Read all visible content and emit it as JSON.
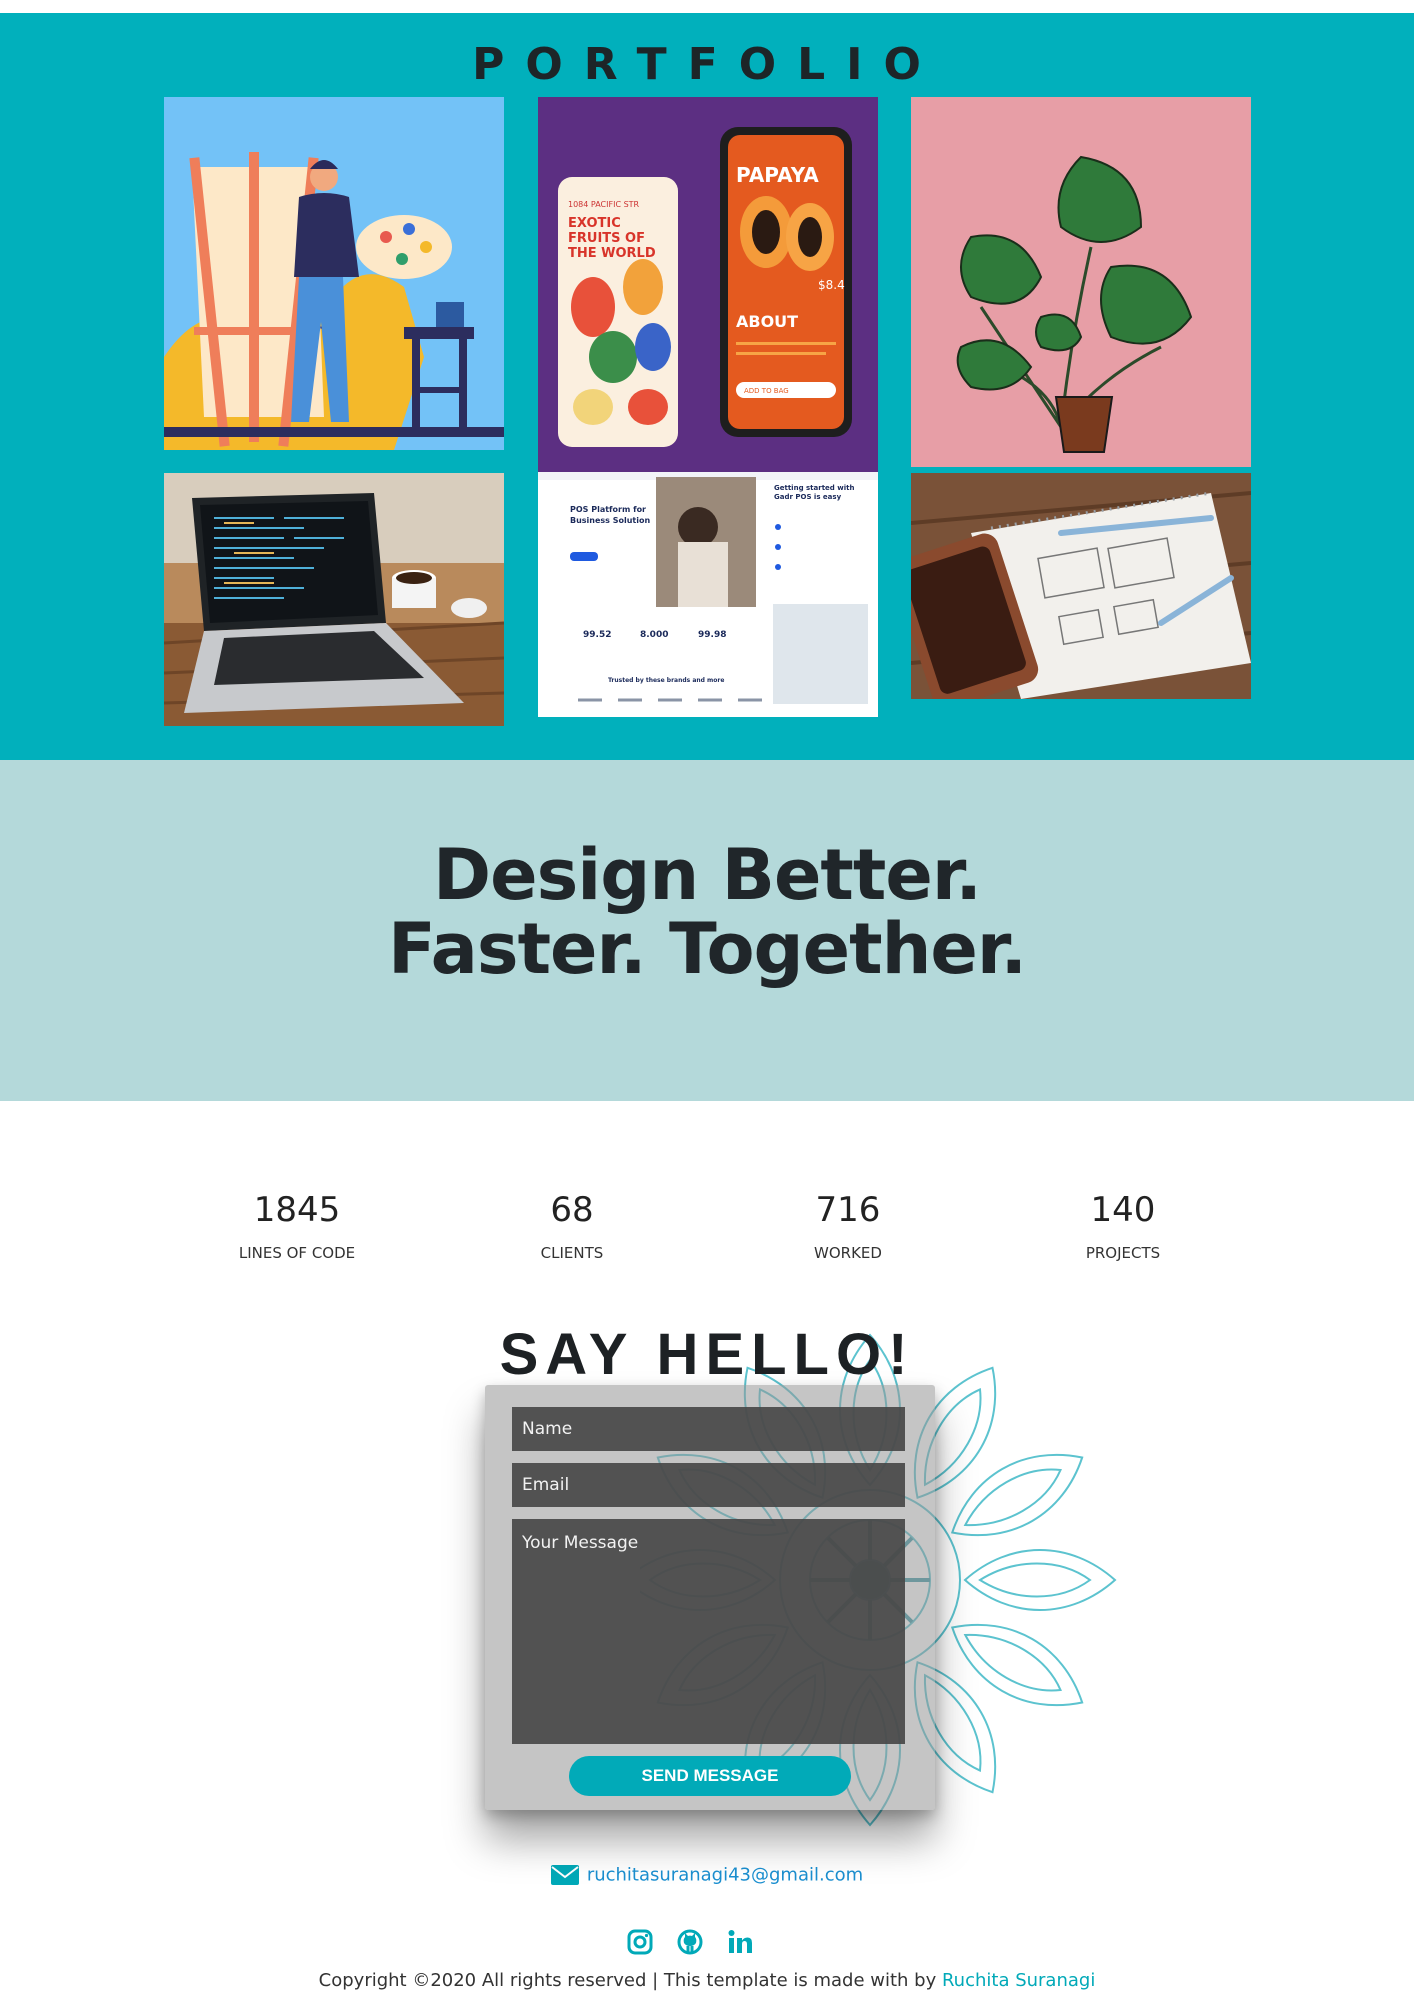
{
  "portfolio": {
    "title": "PORTFOLIO",
    "background": "#01b0bc",
    "tiles": [
      {
        "name": "artist-illustration"
      },
      {
        "name": "fruit-app-mockup",
        "app_heading": "EXOTIC FRUITS OF THE WORLD",
        "app_title": "PAPAYA",
        "app_section": "ABOUT",
        "app_button": "ADD TO BAG",
        "app_price": "$8.4",
        "app_address": "1084 PACIFIC STR"
      },
      {
        "name": "monstera-plant"
      },
      {
        "name": "laptop-code-photo"
      },
      {
        "name": "pos-landing-page",
        "headline": "POS Platform for Business Solution",
        "side_title": "Getting started with Gadr POS is easy",
        "stat1": "99.52",
        "stat2": "8.000",
        "stat3": "99.98",
        "trusted": "Trusted by these brands and more"
      },
      {
        "name": "wireframe-sketch-photo"
      }
    ]
  },
  "tagline": {
    "line1": "Design Better.",
    "line2": "Faster. Together.",
    "background": "#b4d9da"
  },
  "stats": [
    {
      "value": "1845",
      "label": "LINES OF CODE"
    },
    {
      "value": "68",
      "label": "CLIENTS"
    },
    {
      "value": "716",
      "label": "WORKED"
    },
    {
      "value": "140",
      "label": "PROJECTS"
    }
  ],
  "contact": {
    "heading": "SAY HELLO!",
    "name_placeholder": "Name",
    "email_placeholder": "Email",
    "message_placeholder": "Your Message",
    "send_label": "SEND MESSAGE",
    "accent": "#01aab8"
  },
  "footer": {
    "email": "ruchitasuranagi43@gmail.com",
    "email_icon": "envelope-icon",
    "socials": [
      "instagram-icon",
      "github-icon",
      "linkedin-icon"
    ],
    "copyright": "Copyright ©2020 All rights reserved | This template is made with by ",
    "author": "Ruchita Suranagi",
    "link_color": "#1b8fd0"
  }
}
